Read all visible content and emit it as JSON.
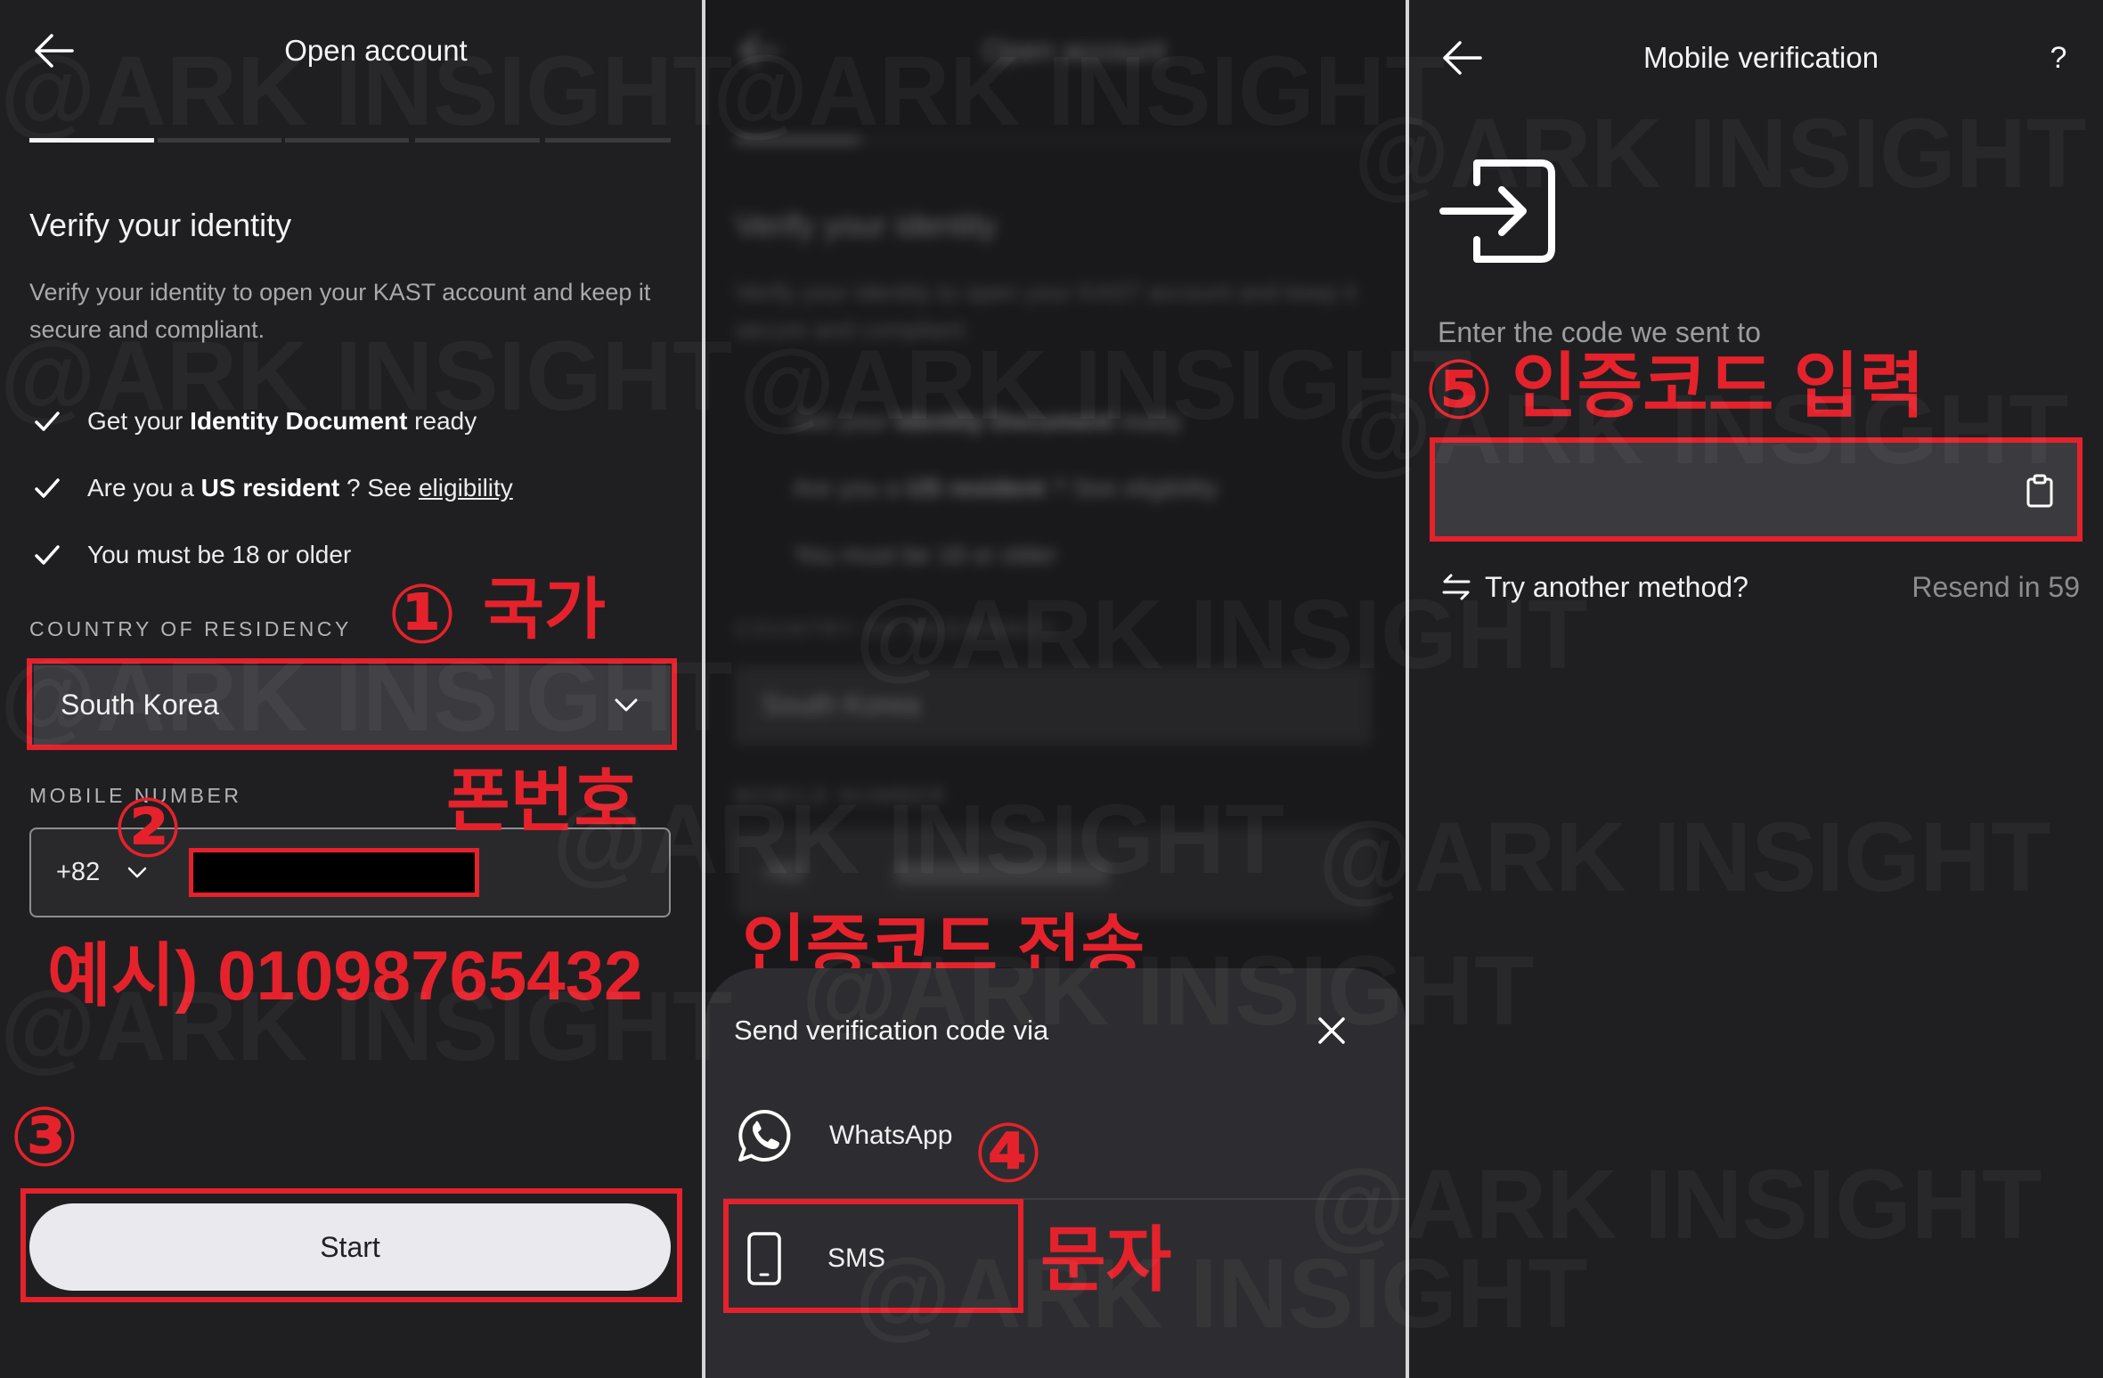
{
  "colors": {
    "background": "#1f1f21",
    "annotation": "#e5222b",
    "field": "#3b3b3f",
    "button": "#e9e9ee",
    "sheet": "#2d2d31"
  },
  "watermark": "@ARK INSIGHT",
  "open_account": {
    "title": "Open account",
    "progress": {
      "current_step": 1,
      "total_steps": 5
    },
    "heading": "Verify your identity",
    "description": "Verify your identity to open your KAST account and keep it secure and compliant.",
    "checklist": [
      {
        "prefix": "Get your ",
        "bold": "Identity Document",
        "suffix": " ready",
        "icon": "check-icon"
      },
      {
        "prefix": "Are you a ",
        "bold": "US resident",
        "suffix": " ? See ",
        "link": "eligibility",
        "icon": "check-icon"
      },
      {
        "prefix": "You must be 18 or older",
        "icon": "check-icon"
      }
    ],
    "country_label": "COUNTRY OF RESIDENCY",
    "country_value": "South Korea",
    "mobile_label": "MOBILE NUMBER",
    "dial_code": "+82",
    "start_label": "Start"
  },
  "verification_sheet": {
    "title": "Send verification code via",
    "options": [
      {
        "label": "WhatsApp",
        "icon": "whatsapp-icon"
      },
      {
        "label": "SMS",
        "icon": "mobile-phone-icon"
      }
    ]
  },
  "mobile_verification": {
    "title": "Mobile verification",
    "help": "?",
    "prompt": "Enter the code we sent to",
    "try_another": "Try another method?",
    "resend": "Resend in 59"
  },
  "annotations": {
    "country": {
      "number": "①",
      "label": "국가"
    },
    "phone": {
      "number": "②",
      "label": "폰번호"
    },
    "phone_example": "예시) 01098765432",
    "start": {
      "number": "③"
    },
    "send_code": "인증코드 전송",
    "sms": {
      "number": "④",
      "label": "문자"
    },
    "enter_code": {
      "number": "⑤",
      "label": "인증코드 입력"
    }
  }
}
